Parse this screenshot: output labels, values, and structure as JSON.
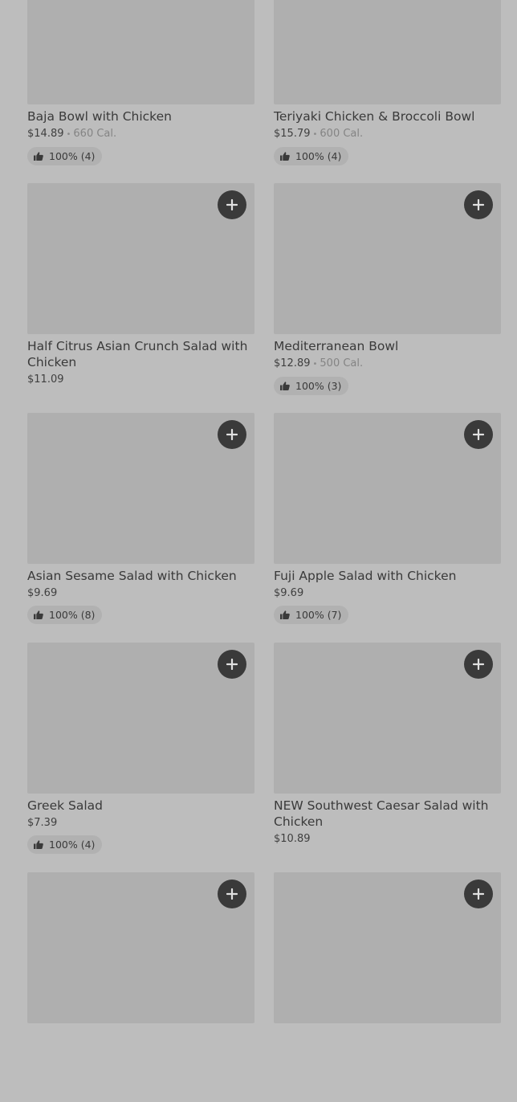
{
  "items": [
    {
      "name": "Baja Bowl with Chicken",
      "price": "$14.89",
      "calories": "660 Cal.",
      "rating": "100% (4)"
    },
    {
      "name": "Teriyaki Chicken & Broccoli Bowl",
      "price": "$15.79",
      "calories": "600 Cal.",
      "rating": "100% (4)"
    },
    {
      "name": "Half Citrus Asian Crunch Salad with Chicken",
      "price": "$11.09",
      "calories": "",
      "rating": ""
    },
    {
      "name": "Mediterranean Bowl",
      "price": "$12.89",
      "calories": "500 Cal.",
      "rating": "100% (3)"
    },
    {
      "name": "Asian Sesame Salad with Chicken",
      "price": "$9.69",
      "calories": "",
      "rating": "100% (8)"
    },
    {
      "name": "Fuji Apple Salad with Chicken",
      "price": "$9.69",
      "calories": "",
      "rating": "100% (7)"
    },
    {
      "name": "Greek Salad",
      "price": "$7.39",
      "calories": "",
      "rating": "100% (4)"
    },
    {
      "name": "NEW Southwest Caesar Salad with Chicken",
      "price": "$10.89",
      "calories": "",
      "rating": ""
    },
    {
      "name": "",
      "price": "",
      "calories": "",
      "rating": ""
    },
    {
      "name": "",
      "price": "",
      "calories": "",
      "rating": ""
    }
  ],
  "icons": {
    "add": "plus-icon",
    "rating": "thumbs-up-icon"
  }
}
